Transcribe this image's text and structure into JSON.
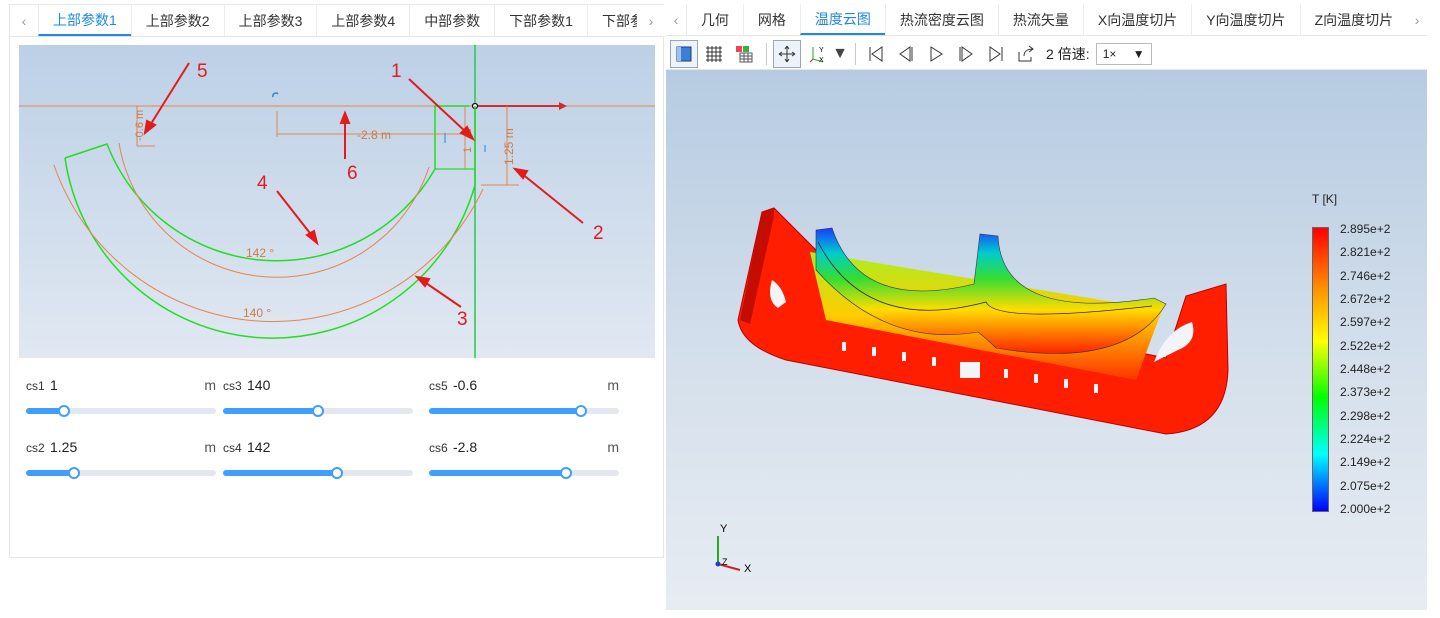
{
  "left_tabs": [
    "上部参数1",
    "上部参数2",
    "上部参数3",
    "上部参数4",
    "中部参数",
    "下部参数1",
    "下部参"
  ],
  "right_tabs": [
    "几何",
    "网格",
    "温度云图",
    "热流密度云图",
    "热流矢量",
    "X向温度切片",
    "Y向温度切片",
    "Z向温度切片"
  ],
  "drawing": {
    "callouts": [
      "1",
      "2",
      "3",
      "4",
      "5",
      "6"
    ],
    "dims": {
      "d1": "-2.8 m",
      "d2": "1.25 m",
      "d3": "-0.6 m",
      "d4": "1",
      "a1": "142 °",
      "a2": "140 °"
    }
  },
  "params": [
    {
      "name": "cs1",
      "value": "1",
      "unit": "m",
      "level": 0.2
    },
    {
      "name": "cs3",
      "value": "140",
      "unit": "",
      "level": 0.5
    },
    {
      "name": "cs5",
      "value": "-0.6",
      "unit": "m",
      "level": 0.8
    },
    {
      "name": "cs2",
      "value": "1.25",
      "unit": "m",
      "level": 0.25
    },
    {
      "name": "cs4",
      "value": "142",
      "unit": "",
      "level": 0.6
    },
    {
      "name": "cs6",
      "value": "-2.8",
      "unit": "m",
      "level": 0.72
    }
  ],
  "toolbar": {
    "frame": "2",
    "speed_label": "倍速:",
    "speed_value": "1×"
  },
  "legend": {
    "title": "T [K]",
    "labels": [
      "2.895e+2",
      "2.821e+2",
      "2.746e+2",
      "2.672e+2",
      "2.597e+2",
      "2.522e+2",
      "2.448e+2",
      "2.373e+2",
      "2.298e+2",
      "2.224e+2",
      "2.149e+2",
      "2.075e+2",
      "2.000e+2"
    ]
  },
  "axes": {
    "y": "Y",
    "z": "Z",
    "x": "X"
  },
  "colors": {
    "accent": "#1e88e5",
    "drawing_green": "#22dd22",
    "dim_orange": "#e8844a",
    "callout_red": "#e21b1b"
  }
}
